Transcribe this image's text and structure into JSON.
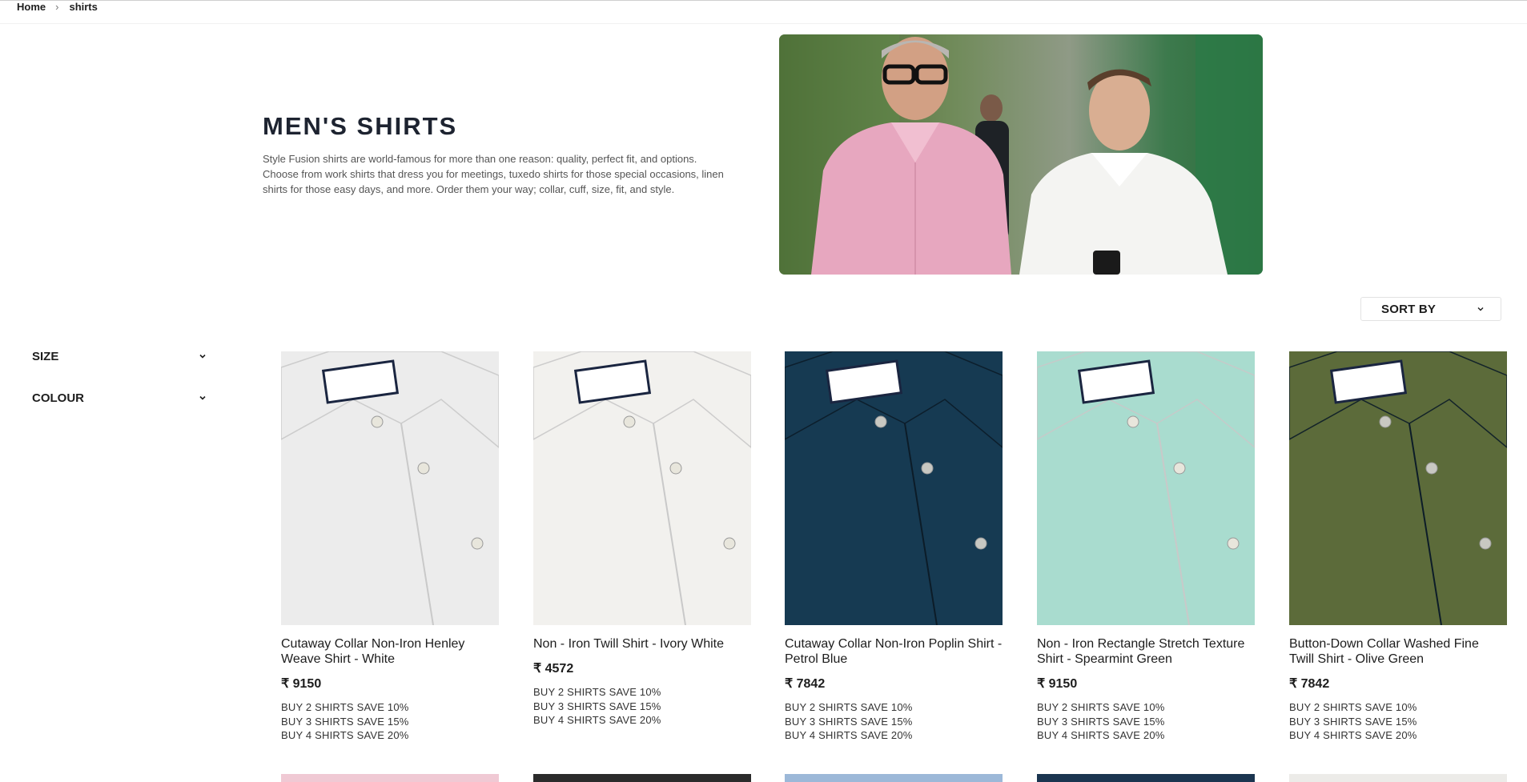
{
  "breadcrumb": {
    "home": "Home",
    "separator": "›",
    "current": "shirts"
  },
  "hero": {
    "title": "MEN'S SHIRTS",
    "description": "Style Fusion shirts are world-famous for more than one reason: quality, perfect fit, and options. Choose from work shirts that dress you for meetings, tuxedo shirts for those special occasions, linen shirts for those easy days, and more. Order them your way; collar, cuff, size, fit, and style."
  },
  "sort": {
    "label": "SORT BY",
    "icon": "chevron-down-icon"
  },
  "filters": [
    {
      "label": "SIZE",
      "icon": "chevron-down-icon"
    },
    {
      "label": "COLOUR",
      "icon": "chevron-down-icon"
    }
  ],
  "products": [
    {
      "name": "Cutaway Collar Non-Iron Henley Weave Shirt - White",
      "price": "₹ 9150",
      "color": "#ececec",
      "promos": [
        "BUY 2 SHIRTS SAVE 10%",
        "BUY 3 SHIRTS SAVE 15%",
        "BUY 4 SHIRTS SAVE 20%"
      ]
    },
    {
      "name": "Non - Iron Twill Shirt - Ivory White",
      "price": "₹ 4572",
      "color": "#f2f1ee",
      "promos": [
        "BUY 2 SHIRTS SAVE 10%",
        "BUY 3 SHIRTS SAVE 15%",
        "BUY 4 SHIRTS SAVE 20%"
      ]
    },
    {
      "name": "Cutaway Collar Non-Iron Poplin Shirt - Petrol Blue",
      "price": "₹ 7842",
      "color": "#163a52",
      "promos": [
        "BUY 2 SHIRTS SAVE 10%",
        "BUY 3 SHIRTS SAVE 15%",
        "BUY 4 SHIRTS SAVE 20%"
      ]
    },
    {
      "name": "Non - Iron Rectangle Stretch Texture Shirt - Spearmint Green",
      "price": "₹ 9150",
      "color": "#a9dccf",
      "promos": [
        "BUY 2 SHIRTS SAVE 10%",
        "BUY 3 SHIRTS SAVE 15%",
        "BUY 4 SHIRTS SAVE 20%"
      ]
    },
    {
      "name": "Button-Down Collar Washed Fine Twill Shirt - Olive Green",
      "price": "₹ 7842",
      "color": "#5c6b3a",
      "promos": [
        "BUY 2 SHIRTS SAVE 10%",
        "BUY 3 SHIRTS SAVE 15%",
        "BUY 4 SHIRTS SAVE 20%"
      ]
    }
  ],
  "next_row_colors": [
    "#f0c9d4",
    "#2b2b2b",
    "#9cb8d8",
    "#1b3550",
    "#ecebe8"
  ]
}
